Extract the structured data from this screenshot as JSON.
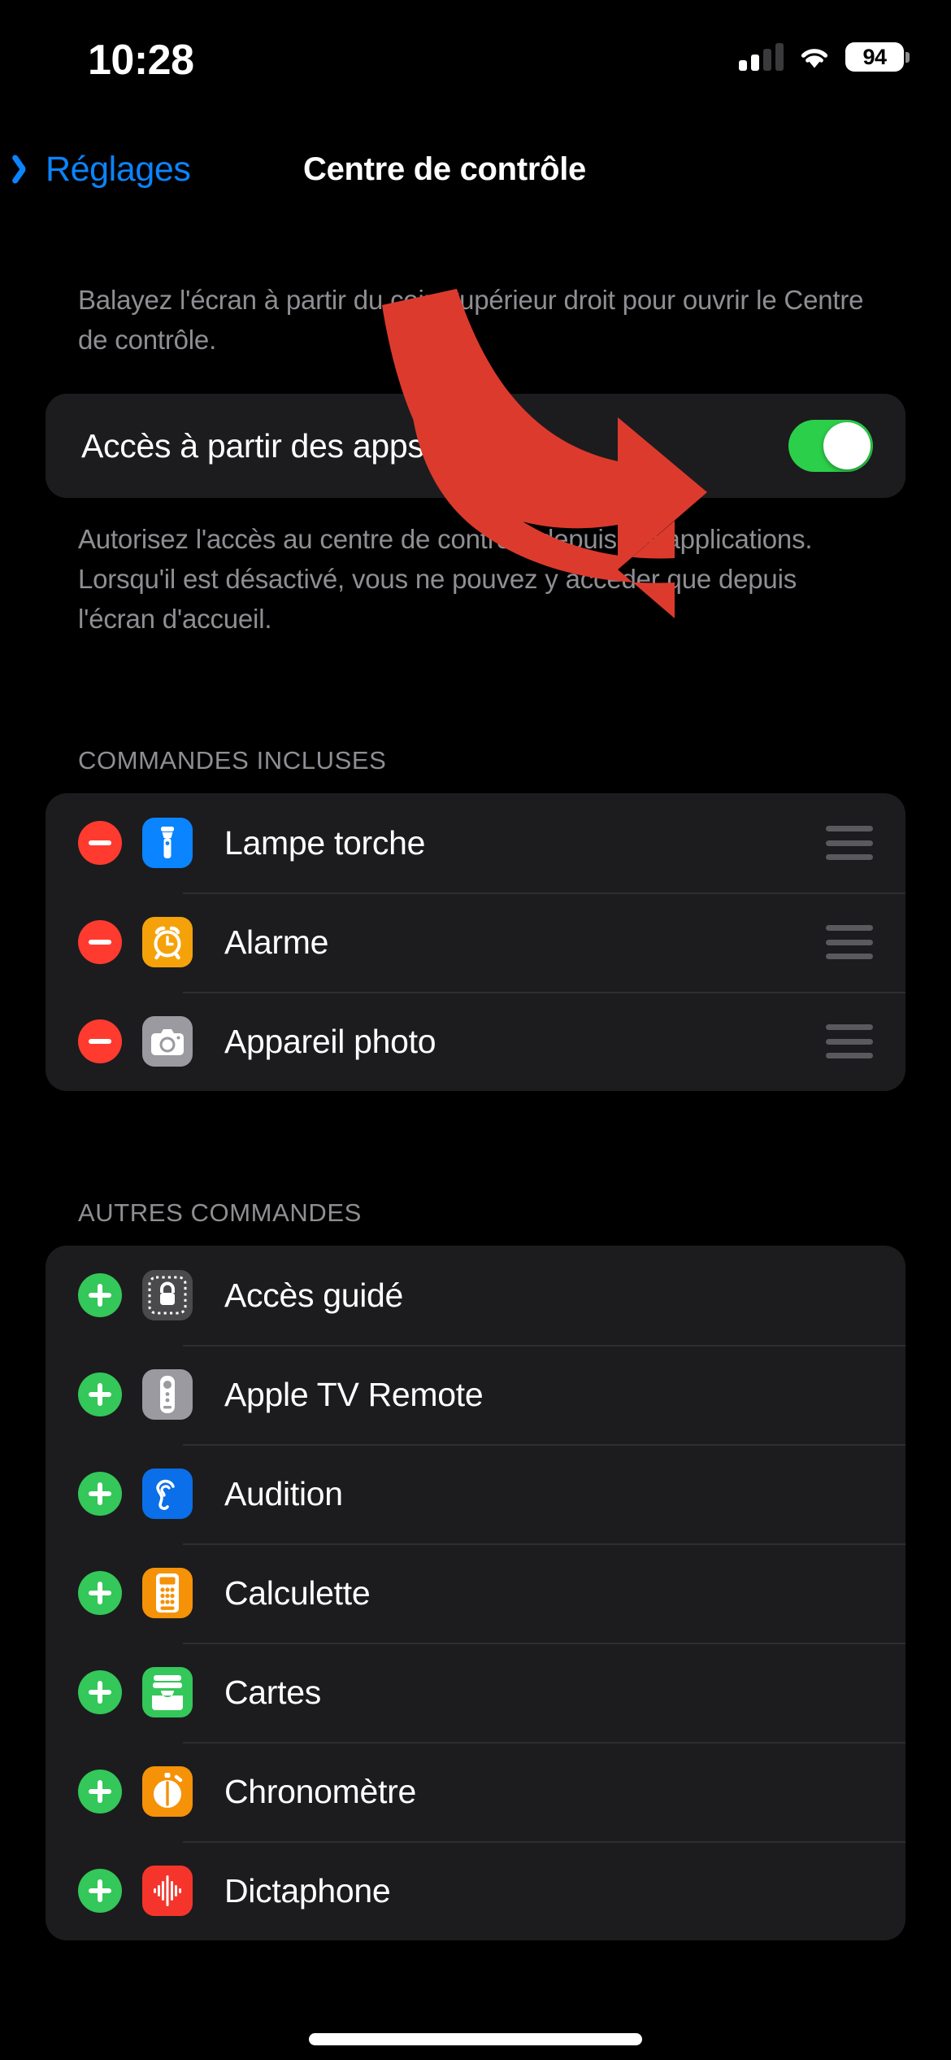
{
  "status_bar": {
    "time": "10:28",
    "battery_percent": "94",
    "signal_icon": "cellular-signal-icon",
    "wifi_icon": "wifi-icon",
    "battery_icon": "battery-icon"
  },
  "nav": {
    "back_label": "Réglages",
    "back_icon": "chevron-left-icon",
    "title": "Centre de contrôle"
  },
  "intro": {
    "text": "Balayez l'écran à partir du coin supérieur droit pour ouvrir le Centre de contrôle."
  },
  "access_toggle": {
    "label": "Accès à partir des apps",
    "state": "on",
    "on_color": "#2ccf4a"
  },
  "access_footer": {
    "text": "Autorisez l'accès au centre de contrôle depuis les applications. Lorsqu'il est désactivé, vous ne pouvez y accéder que depuis l'écran d'accueil."
  },
  "included_section": {
    "caption": "COMMANDES INCLUSES",
    "rows": [
      {
        "label": "Lampe torche",
        "icon": "flashlight-icon",
        "icon_bg": "#0a84ff",
        "action": "remove",
        "handle": "drag-handle-icon"
      },
      {
        "label": "Alarme",
        "icon": "alarm-clock-icon",
        "icon_bg": "#f5a20a",
        "action": "remove",
        "handle": "drag-handle-icon"
      },
      {
        "label": "Appareil photo",
        "icon": "camera-icon",
        "icon_bg": "#9a9aa0",
        "action": "remove",
        "handle": "drag-handle-icon"
      }
    ]
  },
  "other_section": {
    "caption": "AUTRES COMMANDES",
    "rows": [
      {
        "label": "Accès guidé",
        "icon": "guided-access-lock-icon",
        "icon_bg": "#4a4a4c",
        "action": "add"
      },
      {
        "label": "Apple TV Remote",
        "icon": "tv-remote-icon",
        "icon_bg": "#9a9aa0",
        "action": "add"
      },
      {
        "label": "Audition",
        "icon": "ear-hearing-icon",
        "icon_bg": "#0a6fe8",
        "action": "add"
      },
      {
        "label": "Calculette",
        "icon": "calculator-icon",
        "icon_bg": "#f59208",
        "action": "add"
      },
      {
        "label": "Cartes",
        "icon": "wallet-icon",
        "icon_bg": "#34c759",
        "action": "add"
      },
      {
        "label": "Chronomètre",
        "icon": "stopwatch-icon",
        "icon_bg": "#f59208",
        "action": "add"
      },
      {
        "label": "Dictaphone",
        "icon": "voice-memo-waveform-icon",
        "icon_bg": "#f5352b",
        "action": "add"
      }
    ]
  },
  "annotation": {
    "arrow_icon": "curved-red-arrow-icon",
    "arrow_color": "#dd3a2e",
    "points_at": "Accès à partir des apps toggle"
  },
  "home_indicator": {
    "icon": "home-indicator-bar"
  },
  "colors": {
    "background": "#000000",
    "card": "#1c1c1e",
    "accent_blue": "#0a84ff",
    "secondary_text": "#8e8e93",
    "separator": "#2e2e30",
    "remove_red": "#ff3b30",
    "add_green": "#34c759"
  }
}
